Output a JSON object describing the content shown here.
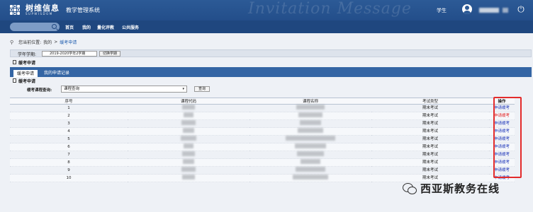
{
  "header": {
    "logo_cn": "树维信息",
    "logo_en": "SUPWISDOM",
    "system_title": "教学管理系统",
    "watermark": "Invitation Message",
    "role": "学生"
  },
  "nav": {
    "items": [
      "首页",
      "我的",
      "量化评教",
      "公共服务"
    ]
  },
  "breadcrumb": {
    "prefix": "您当前位置:",
    "parent": "我的",
    "sep": ">",
    "current": "缓考申请"
  },
  "semester": {
    "label": "学年学期:",
    "value": "2019-2020学年2学期",
    "switch_button": "切换学期"
  },
  "sections": {
    "top": "缓考申请",
    "inner": "缓考申请"
  },
  "tabs": {
    "active": "缓考申请",
    "other": "我的申请记录"
  },
  "query": {
    "label": "缓考课程查询:",
    "select_value": "课程查询",
    "button": "查询"
  },
  "table": {
    "headers": [
      "序号",
      "课程代码",
      "课程名称",
      "考试类型",
      "操作"
    ],
    "rows": [
      {
        "no": "1",
        "exam_type": "期末考试",
        "action": "申请缓考",
        "hl": false
      },
      {
        "no": "2",
        "exam_type": "期末考试",
        "action": "申请缓考",
        "hl": true
      },
      {
        "no": "3",
        "exam_type": "期末考试",
        "action": "申请缓考",
        "hl": false
      },
      {
        "no": "4",
        "exam_type": "期末考试",
        "action": "申请缓考",
        "hl": false
      },
      {
        "no": "5",
        "exam_type": "期末考试",
        "action": "申请缓考",
        "hl": false
      },
      {
        "no": "6",
        "exam_type": "期末考试",
        "action": "申请缓考",
        "hl": false
      },
      {
        "no": "7",
        "exam_type": "期末考试",
        "action": "申请缓考",
        "hl": false
      },
      {
        "no": "8",
        "exam_type": "期末考试",
        "action": "申请缓考",
        "hl": false
      },
      {
        "no": "9",
        "exam_type": "期末考试",
        "action": "申请缓考",
        "hl": false
      },
      {
        "no": "10",
        "exam_type": "期末考试",
        "action": "申请缓考",
        "hl": false
      }
    ]
  },
  "footer": {
    "badge": "西亚斯教务在线"
  },
  "colors": {
    "header_bg": "#234e8a",
    "nav_bg": "#1f477f",
    "tab_bg": "#3465a4",
    "action_link": "#1d35b8",
    "highlight": "#e32b2b"
  },
  "icons": [
    "logo-icon",
    "avatar-icon",
    "power-icon",
    "search-icon",
    "location-pin-icon",
    "document-icon",
    "chevron-down-icon",
    "wechat-icon"
  ]
}
